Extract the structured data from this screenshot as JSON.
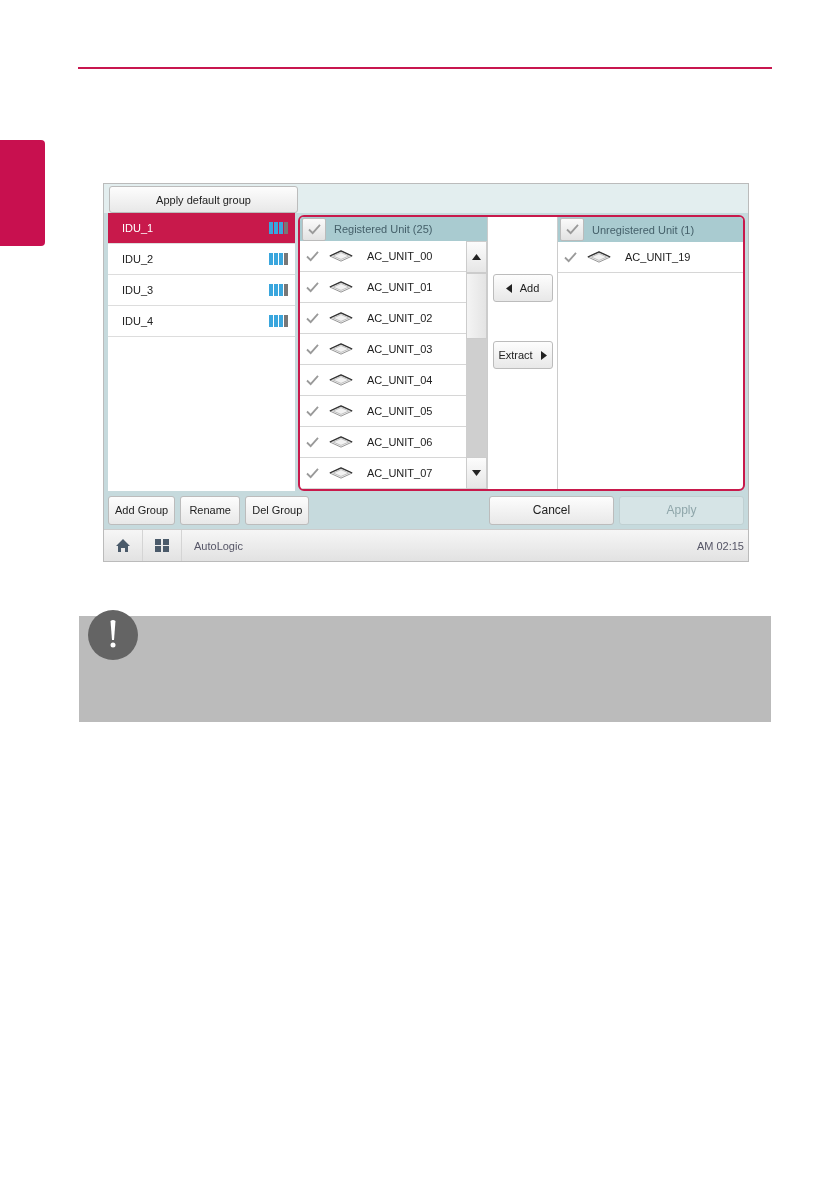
{
  "screen": {
    "top_button": "Apply default group",
    "groups": [
      {
        "name": "IDU_1",
        "selected": true
      },
      {
        "name": "IDU_2",
        "selected": false
      },
      {
        "name": "IDU_3",
        "selected": false
      },
      {
        "name": "IDU_4",
        "selected": false
      }
    ],
    "registered": {
      "title": "Registered Unit (25)",
      "checked": true,
      "units": [
        "AC_UNIT_00",
        "AC_UNIT_01",
        "AC_UNIT_02",
        "AC_UNIT_03",
        "AC_UNIT_04",
        "AC_UNIT_05",
        "AC_UNIT_06",
        "AC_UNIT_07"
      ]
    },
    "move_buttons": [
      {
        "label": "Add",
        "kind": "left"
      },
      {
        "label": "Extract",
        "kind": "right"
      }
    ],
    "unregistered": {
      "title": "Unregistered Unit (1)",
      "checked": true,
      "units": [
        "AC_UNIT_19"
      ]
    },
    "group_buttons": [
      "Add Group",
      "Rename",
      "Del Group"
    ],
    "actions": [
      {
        "label": "Cancel",
        "disabled": false
      },
      {
        "label": "Apply",
        "disabled": true
      }
    ],
    "status_bar": {
      "app": "AutoLogic",
      "time": "AM 02:15"
    }
  }
}
